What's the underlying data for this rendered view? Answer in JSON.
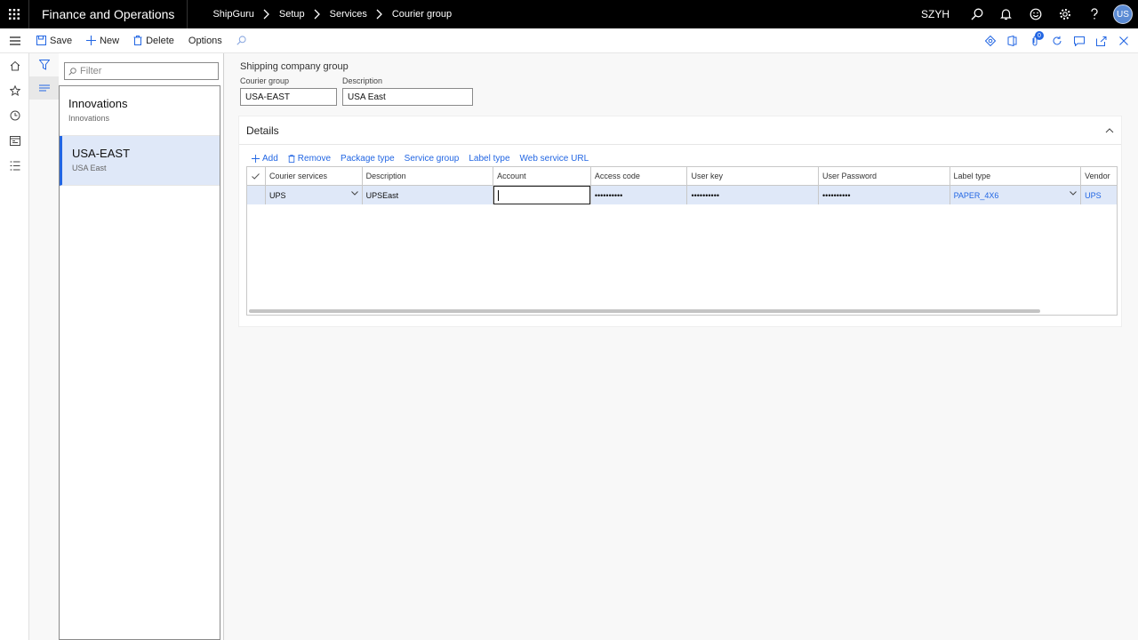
{
  "topbar": {
    "app_name": "Finance and Operations",
    "breadcrumbs": [
      "ShipGuru",
      "Setup",
      "Services",
      "Courier group"
    ],
    "company": "SZYH",
    "avatar_initials": "US"
  },
  "actions": {
    "save": "Save",
    "new": "New",
    "delete": "Delete",
    "options": "Options",
    "notification_count": "0"
  },
  "list": {
    "filter_placeholder": "Filter",
    "items": [
      {
        "title": "Innovations",
        "subtitle": "Innovations"
      },
      {
        "title": "USA-EAST",
        "subtitle": "USA East"
      }
    ]
  },
  "form": {
    "page_title": "Shipping company group",
    "courier_group_label": "Courier group",
    "courier_group_value": "USA-EAST",
    "description_label": "Description",
    "description_value": "USA East"
  },
  "details": {
    "title": "Details",
    "toolbar": {
      "add": "Add",
      "remove": "Remove",
      "package_type": "Package type",
      "service_group": "Service group",
      "label_type": "Label type",
      "web_service_url": "Web service URL"
    },
    "columns": [
      "Courier services",
      "Description",
      "Account",
      "Access code",
      "User key",
      "User Password",
      "Label type",
      "Vendor"
    ],
    "rows": [
      {
        "courier_services": "UPS",
        "description": "UPSEast",
        "account": "",
        "access_code": "••••••••••",
        "user_key": "••••••••••",
        "user_password": "••••••••••",
        "label_type": "PAPER_4X6",
        "vendor": "UPS"
      }
    ]
  },
  "colors": {
    "accent": "#2266e3",
    "selected_row": "#dfe8f8",
    "topbar": "#000000"
  }
}
